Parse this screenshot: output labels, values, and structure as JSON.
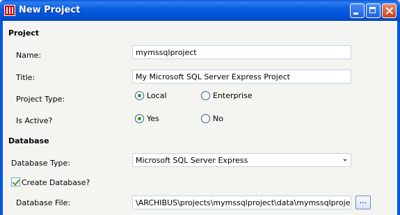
{
  "window": {
    "title": "New Project",
    "buttons": {
      "minimize": "minimize",
      "maximize": "maximize",
      "close": "close"
    }
  },
  "project_section": {
    "heading": "Project",
    "name_label": "Name:",
    "name_value": "mymssqlproject",
    "title_label": "Title:",
    "title_value": "My Microsoft SQL Server Express Project",
    "type_label": "Project Type:",
    "type_options": [
      "Local",
      "Enterprise"
    ],
    "type_selected": "Local",
    "active_label": "Is Active?",
    "active_options": [
      "Yes",
      "No"
    ],
    "active_selected": "Yes"
  },
  "database_section": {
    "heading": "Database",
    "db_type_label": "Database Type:",
    "db_type_value": "Microsoft SQL Server Express",
    "create_db_label": "Create Database?",
    "create_db_checked": true,
    "db_file_label": "Database File:",
    "db_file_value": "\\ARCHIBUS\\projects\\mymssqlproject\\data\\mymssqlproject.mdf",
    "browse_label": "..."
  },
  "colors": {
    "titlebar": "#0a5fe0",
    "client_bg": "#f4f4f0",
    "radio_dot": "#3a9a26"
  }
}
